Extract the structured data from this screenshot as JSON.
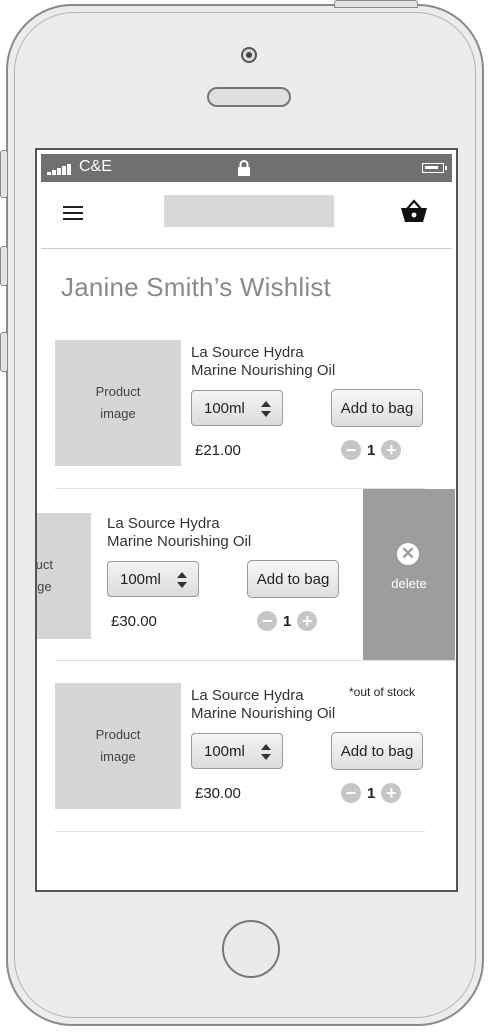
{
  "statusbar": {
    "carrier": "C&E"
  },
  "page": {
    "title": "Janine Smith’s Wishlist"
  },
  "items": [
    {
      "image_line1": "Product",
      "image_line2": "image",
      "name_line1": "La Source Hydra",
      "name_line2": "Marine Nourishing Oil",
      "size": "100ml",
      "price": "£21.00",
      "add_label": "Add to bag",
      "quantity": "1",
      "note": ""
    },
    {
      "image_line1": "uct",
      "image_line2": "ge",
      "name_line1": "La Source Hydra",
      "name_line2": "Marine Nourishing Oil",
      "size": "100ml",
      "price": "£30.00",
      "add_label": "Add to bag",
      "quantity": "1",
      "delete_label": "delete"
    },
    {
      "image_line1": "Product",
      "image_line2": "image",
      "name_line1": "La Source Hydra",
      "name_line2": "Marine Nourishing Oil",
      "size": "100ml",
      "price": "£30.00",
      "add_label": "Add to bag",
      "quantity": "1",
      "note": "*out of stock"
    }
  ],
  "icons": {
    "menu": "menu-icon",
    "basket": "basket-icon",
    "lock": "lock-icon",
    "signal": "signal-icon",
    "battery": "battery-icon",
    "minus": "minus-icon",
    "plus": "plus-icon",
    "delete": "close-icon",
    "stepper": "sort-arrows-icon"
  },
  "colors": {
    "statusbar": "#707070",
    "delete_panel": "#9d9d9d",
    "placeholder": "#d6d6d6",
    "title": "#8a8a8a"
  }
}
